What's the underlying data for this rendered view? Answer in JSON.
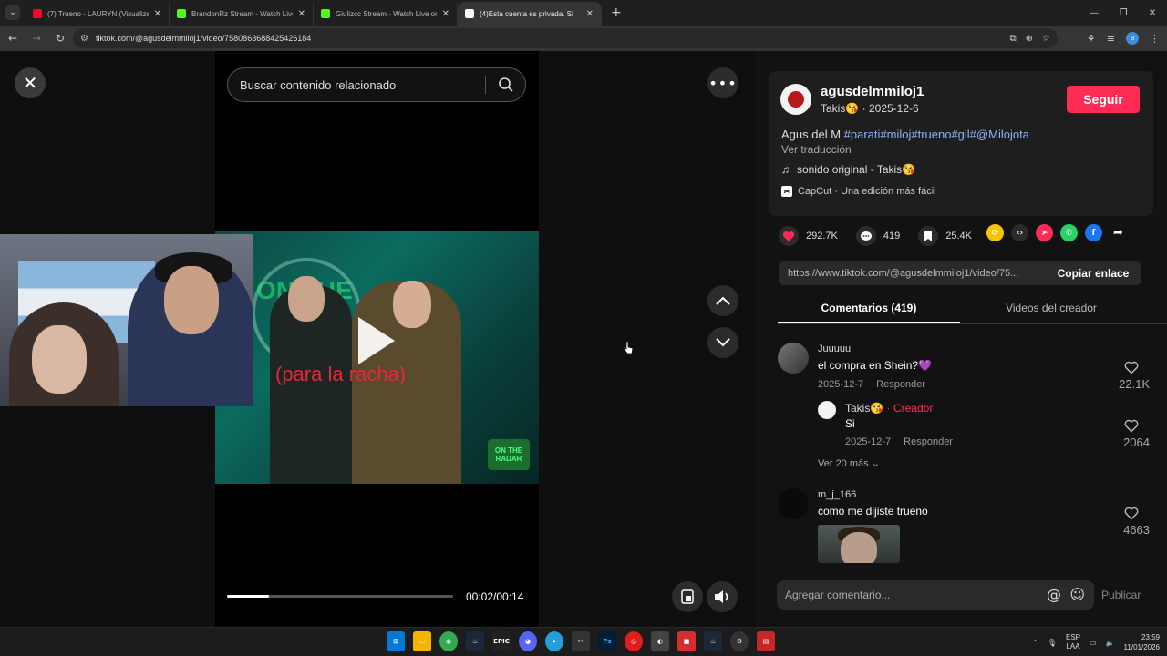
{
  "browser": {
    "tabs": [
      {
        "title": "(7) Trueno - LAURYN (Visualizer",
        "color": "#ff0033",
        "active": false
      },
      {
        "title": "BrandonRz Stream - Watch Live",
        "color": "#53fc18",
        "active": false
      },
      {
        "title": "Giulizcc Stream - Watch Live on",
        "color": "#53fc18",
        "active": false
      },
      {
        "title": "(4)Esta cuenta es privada. Si",
        "color": "#ffffff",
        "active": true
      }
    ],
    "url": "tiktok.com/@agusdelmmiloj1/video/7580863688425426184",
    "profile_initials": "B"
  },
  "player": {
    "search_placeholder": "Buscar contenido relacionado",
    "caption": "(para la racha)",
    "progress_fraction": 0.185,
    "time": "00:02/00:14",
    "overlay_logo": "ON THE RADAR"
  },
  "post": {
    "username": "agusdelmmiloj1",
    "nickname": "Takis😘",
    "date": "2025-12-6",
    "follow_label": "Seguir",
    "desc_text": "Agus del M ",
    "hashtags": "#parati#miloj#trueno#gil#@Milojota",
    "translate": "Ver traducción",
    "sound": "sonido original - Takis😘",
    "capcut": "CapCut · Una edición más fácil",
    "likes": "292.7K",
    "comments_count": "419",
    "saves": "25.4K",
    "share_url": "https://www.tiktok.com/@agusdelmmiloj1/video/75...",
    "copy_label": "Copiar enlace"
  },
  "tabs": {
    "comments": "Comentarios (419)",
    "creator_videos": "Videos del creador"
  },
  "comments": [
    {
      "name": "Juuuuu",
      "text": "el compra en Shein?💜",
      "date": "2025-12-7",
      "reply": "Responder",
      "likes": "22.1K"
    },
    {
      "name": "Takis😘",
      "creator_label": "· Creador",
      "text": "Si",
      "date": "2025-12-7",
      "reply": "Responder",
      "likes": "2064"
    },
    {
      "name": "m_j_166",
      "text": "como me dijiste trueno",
      "likes": "4663"
    }
  ],
  "more_replies": "Ver 20 más",
  "composer": {
    "placeholder": "Agregar comentario...",
    "publish": "Publicar"
  },
  "taskbar": {
    "lang1": "ESP",
    "lang2": "LAA",
    "time": "23:59",
    "date": "11/01/2026"
  },
  "colors": {
    "follow": "#fe2c55",
    "like": "#fe2c55",
    "hashtag": "#8ab4f8"
  }
}
